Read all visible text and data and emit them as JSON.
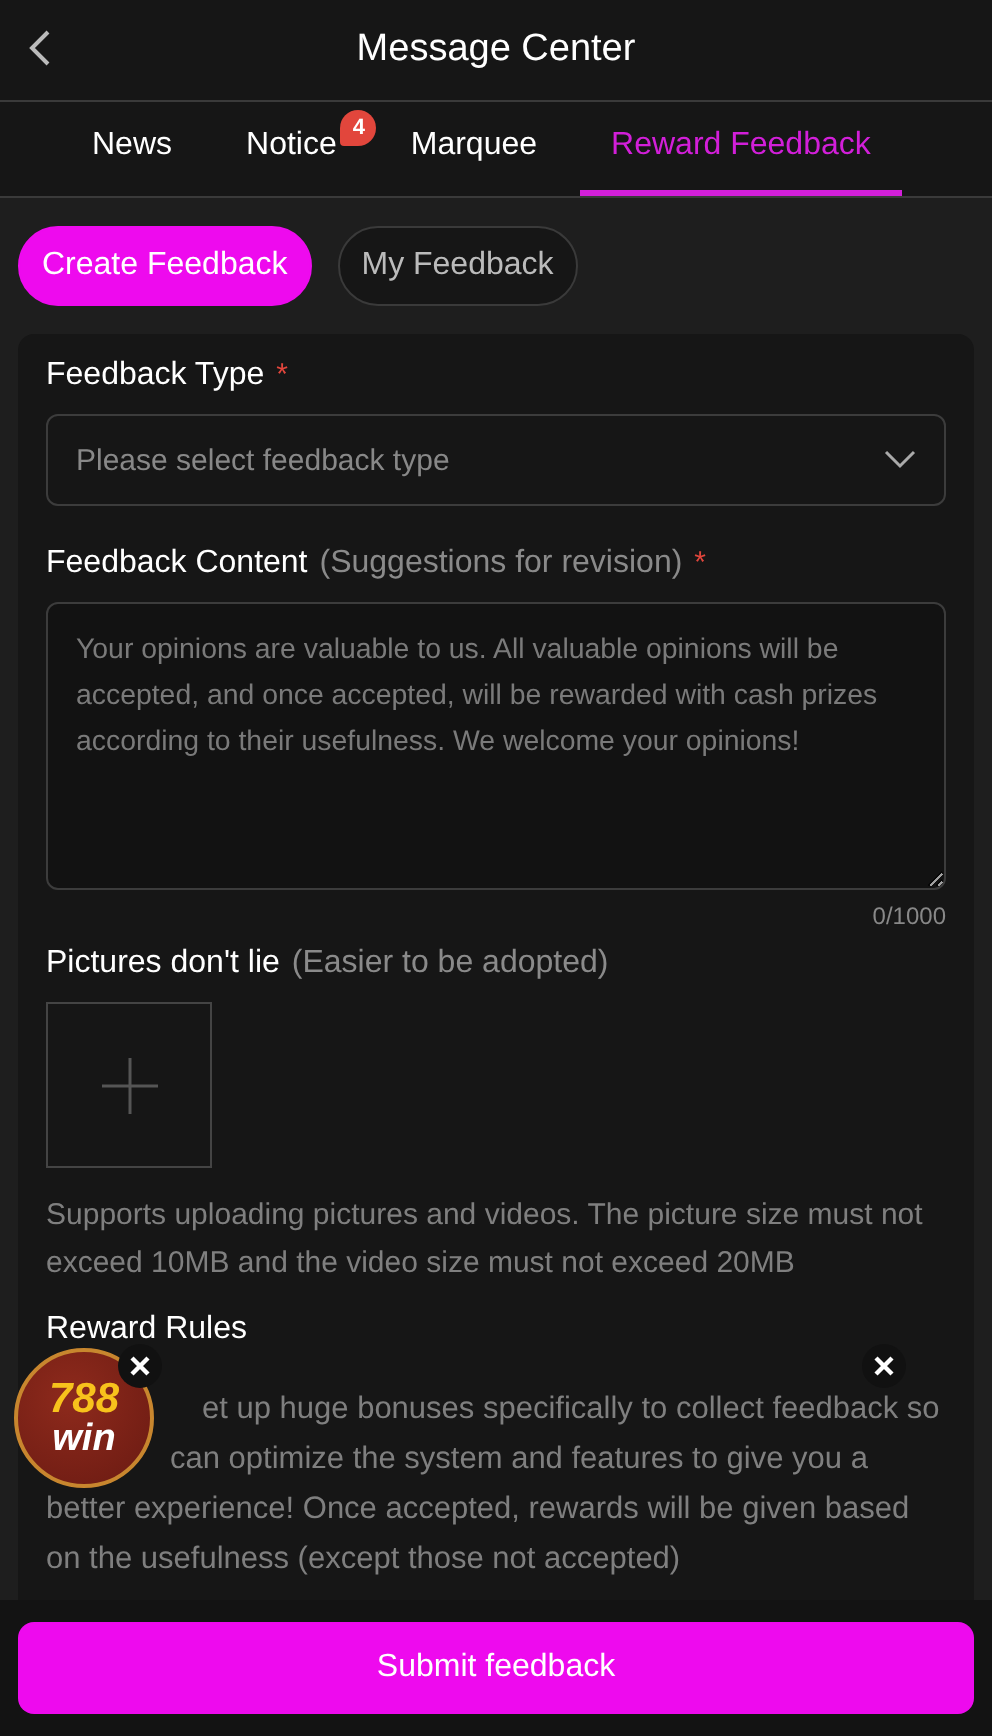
{
  "header": {
    "title": "Message Center"
  },
  "tabs": [
    {
      "label": "News",
      "selected": false
    },
    {
      "label": "Notice",
      "selected": false,
      "badge": "4"
    },
    {
      "label": "Marquee",
      "selected": false
    },
    {
      "label": "Reward Feedback",
      "selected": true
    }
  ],
  "segments": [
    {
      "label": "Create Feedback",
      "selected": true
    },
    {
      "label": "My Feedback",
      "selected": false
    }
  ],
  "form": {
    "type_field": {
      "label": "Feedback Type",
      "required_mark": "*",
      "placeholder": "Please select feedback type"
    },
    "content_field": {
      "label": "Feedback Content",
      "hint": "(Suggestions for revision)",
      "required_mark": "*",
      "placeholder": "Your opinions are valuable to us. All valuable opinions will be accepted, and once accepted, will be rewarded with cash prizes according to their usefulness. We welcome your opinions!",
      "counter": "0/1000"
    },
    "pictures": {
      "label": "Pictures don't lie",
      "hint": "(Easier to be adopted)",
      "note": "Supports uploading pictures and videos. The picture size must not exceed 10MB and the video size must not exceed 20MB"
    },
    "rules": {
      "title": "Reward Rules",
      "lines": [
        "et up huge bonuses specifically to collect feedback so",
        "can optimize the system and features to give you a",
        "better experience! Once accepted, rewards will be given based",
        "on the usefulness (except those not accepted)"
      ]
    }
  },
  "floating_badge": {
    "line_1": "788",
    "line_2": "win"
  },
  "submit_button": "Submit feedback"
}
